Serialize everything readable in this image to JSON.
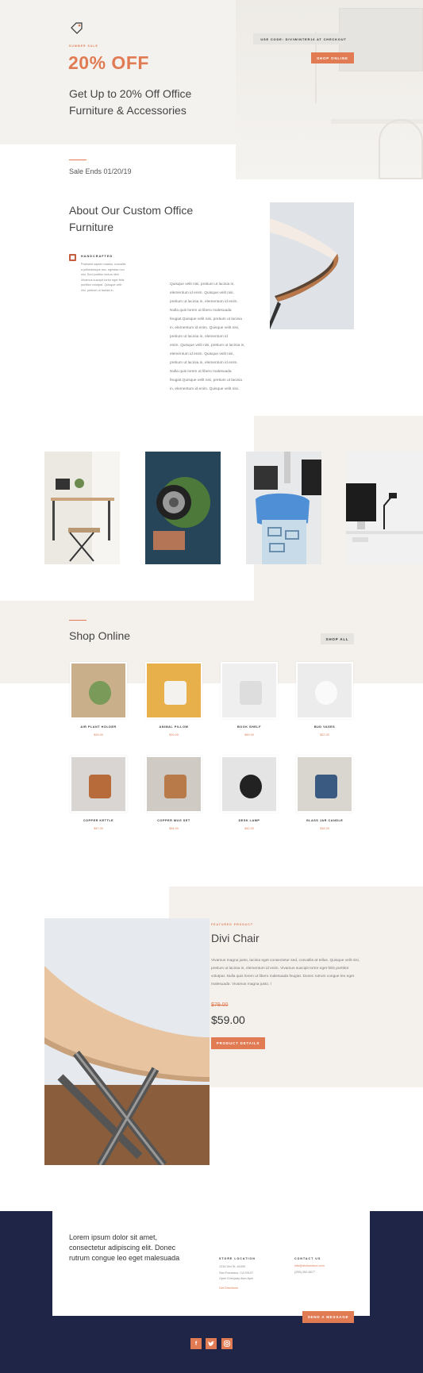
{
  "hero": {
    "eyebrow": "SUMMER SALE",
    "headline": "20% OFF",
    "subhead_line1": "Get Up to 20% Off Office",
    "subhead_line2": "Furniture & Accessories",
    "code_badge": "USE CODE: DIVIWINTER16 AT CHECKOUT",
    "shop_button": "SHOP ONLINE",
    "sale_ends": "Sale Ends 01/20/19"
  },
  "about": {
    "title_line1": "About Our Custom Office",
    "title_line2": "Furniture",
    "feature_label": "HANDCRAFTED",
    "feature_text": [
      "Praesent sapien massa, convallis",
      "a pellentesque nec, egestas non",
      "nisi. Sed porttitor lectus nibh.",
      "Vivamus suscipit tortor eget felis",
      "porttitor volutpat. Quisque velit",
      "nisi, pretium ut lacinia in."
    ],
    "body_lines": [
      "Quisque velit nisi, pretium ut lacinia in,",
      "elementum id enim. Quisque velit nisi,",
      "pretium ut lacinia in, elementum id enim.",
      "Nulla quis lorem ut libero malesuada",
      "feugiat.Quisque velit nisi, pretium ut lacinia",
      "in, elementum id enim. Quisque velit nisi,",
      "pretium ut lacinia in, elementum id",
      "enim. Quisque velit nisi, pretium ut lacinia in,",
      "elementum id enim. Quisque velit nisi,",
      "pretium ut lacinia in, elementum id enim.",
      "Nulla quis lorem ut libero malesuada",
      "feugiat.Quisque velit nisi, pretium ut lacinia",
      "in, elementum id enim. Quisque velit nisi."
    ]
  },
  "shop": {
    "title": "Shop Online",
    "shop_all": "SHOP ALL",
    "products": [
      {
        "name": "AIR PLANT HOLDER",
        "price": "$19.00"
      },
      {
        "name": "ANIMAL PILLOW",
        "price": "$19.00"
      },
      {
        "name": "BOOK SHELF",
        "price": "$49.00"
      },
      {
        "name": "BUD VASES",
        "price": "$22.00"
      },
      {
        "name": "COPPER KETTLE",
        "price": "$47.00"
      },
      {
        "name": "COPPER MUG SET",
        "price": "$34.00"
      },
      {
        "name": "DESK LAMP",
        "price": "$42.00"
      },
      {
        "name": "GLASS JAR CANDLE",
        "price": "$18.00"
      }
    ]
  },
  "featured": {
    "eyebrow": "FEATURED PRODUCT",
    "title": "Divi Chair",
    "desc_lines": [
      "Vivamus magna justo, lacinia eget consectetur sed, convallis at tellus. Quisque velit nisi,",
      "pretium ut lacinia in, elementum id enim. Vivamus suscipit tortor eget felis porttitor",
      "volutpat. Nulla quis lorem ut libero malesuada feugiat. Donec rutrum congue leo eget",
      "malesuada. Vivamus magna justo, l"
    ],
    "old_price": "$79.00",
    "price": "$59.00",
    "button": "PRODUCT DETAILS"
  },
  "footer": {
    "tagline_lines": [
      "Lorem ipsum dolor sit amet,",
      "consectetur adipiscing elit. Donec",
      "rutrum congue leo eget malesuada"
    ],
    "store_heading": "STORE LOCATION",
    "store_lines": [
      "1234 Divi St. #1000",
      "San Francisco, CA 93107",
      "Open Everyday 8am-5pm"
    ],
    "directions": "Get Directions",
    "contact_heading": "CONTACT US",
    "contact_email": "info@divifurniture.com",
    "contact_phone": "(255) 352-6677",
    "send_button": "SEND A MESSAGE",
    "social": [
      "f",
      "t",
      "ig"
    ]
  },
  "colors": {
    "accent": "#e07b53",
    "navy": "#1e2547",
    "beige": "#f4f1ed"
  }
}
